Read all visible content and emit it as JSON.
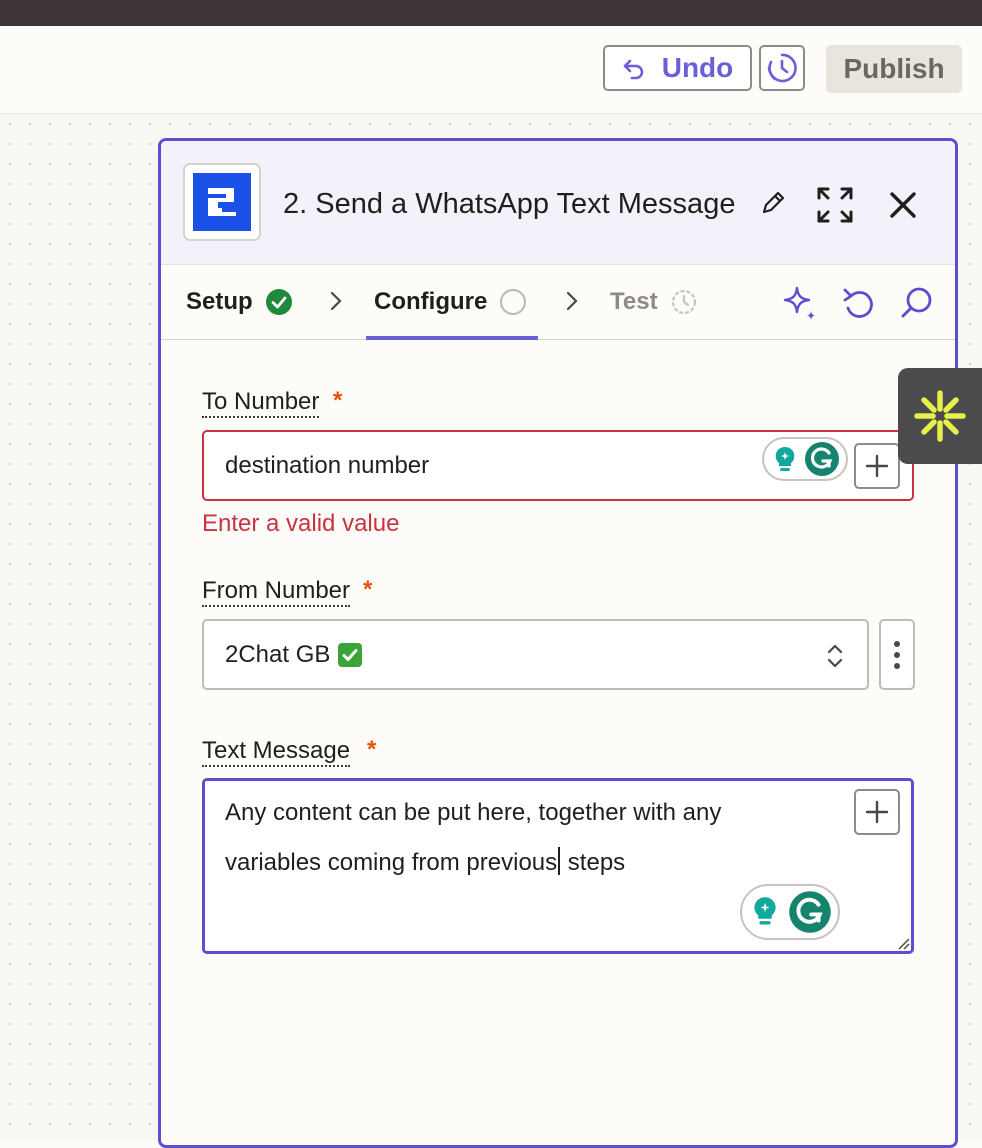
{
  "toolbar": {
    "undo_label": "Undo",
    "publish_label": "Publish",
    "accent_color": "#6a5fd6"
  },
  "panel": {
    "title": "2. Send a WhatsApp Text Message",
    "app_icon": "2chat-logo-icon",
    "border_color": "#5b4fcf"
  },
  "tabs": [
    {
      "label": "Setup",
      "status": "complete",
      "status_icon": "check-circle-icon"
    },
    {
      "label": "Configure",
      "status": "in-progress",
      "status_icon": "empty-circle-icon",
      "active": true
    },
    {
      "label": "Test",
      "status": "pending",
      "status_icon": "timer-icon"
    }
  ],
  "fields": {
    "to_number": {
      "label": "To Number",
      "required_mark": "*",
      "value": "destination number",
      "error": "Enter a valid value"
    },
    "from_number": {
      "label": "From Number",
      "required_mark": "*",
      "selected": "2Chat GB",
      "selected_emoji": "check-mark-button-icon"
    },
    "text_message": {
      "label": "Text Message",
      "required_mark": "*",
      "line1": "Any content can be put here, together with any",
      "line2_before_caret": "variables coming from previous",
      "line2_after_caret": " steps"
    }
  },
  "colors": {
    "error": "#c93240",
    "required": "#e0540a",
    "success": "#1e8a3a"
  }
}
